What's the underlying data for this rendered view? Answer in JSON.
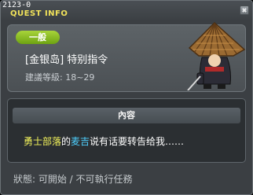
{
  "window": {
    "id_text": "2123-0",
    "title": "QUEST INFO"
  },
  "quest": {
    "badge": "一般",
    "name": "[金银岛] 特别指令",
    "level": "建議等級: 18~29"
  },
  "content": {
    "header": "內容",
    "message": {
      "part1": "勇士部落",
      "part2": "的",
      "part3": "麦吉",
      "part4": "说有话要转告给我……"
    }
  },
  "status": "狀態: 可開始 / 不可執行任務",
  "colors": {
    "title": "#f2e35a",
    "badge": "#8fc126",
    "highlight_place": "#f2f25b",
    "highlight_npc": "#4fd0ff"
  },
  "icons": {
    "close": "close-icon",
    "npc": "npc-portrait"
  }
}
